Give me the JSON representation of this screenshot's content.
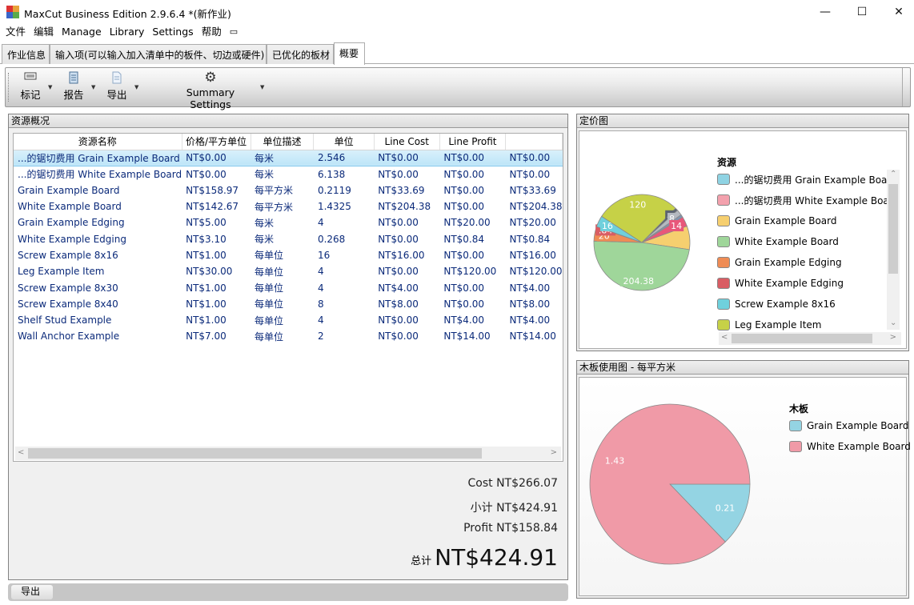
{
  "window": {
    "title": "MaxCut Business Edition 2.9.6.4 *(新作业)",
    "minimize": "—",
    "maximize": "☐",
    "close": "✕"
  },
  "menu": [
    "文件",
    "编辑",
    "Manage",
    "Library",
    "Settings",
    "帮助",
    "▭"
  ],
  "tabs": [
    "作业信息",
    "输入项(可以输入加入清单中的板件、切边或硬件)",
    "已优化的板材",
    "概要"
  ],
  "active_tab": "概要",
  "toolbar": {
    "items": [
      {
        "label": "标记",
        "icon": "label-icon"
      },
      {
        "label": "报告",
        "icon": "report-icon"
      },
      {
        "label": "导出",
        "icon": "export-icon"
      },
      {
        "label": "Summary Settings",
        "icon": "gear-icon"
      }
    ]
  },
  "resources_panel": {
    "title": "资源概况",
    "columns": [
      "资源名称",
      "价格/平方单位",
      "单位描述",
      "单位",
      "Line Cost",
      "Line Profit",
      ""
    ],
    "rows": [
      [
        "...的锯切费用 Grain Example Board",
        "NT$0.00",
        "每米",
        "2.546",
        "NT$0.00",
        "NT$0.00",
        "NT$0.00"
      ],
      [
        "...的锯切费用 White Example Board",
        "NT$0.00",
        "每米",
        "6.138",
        "NT$0.00",
        "NT$0.00",
        "NT$0.00"
      ],
      [
        "Grain Example Board",
        "NT$158.97",
        "每平方米",
        "0.2119",
        "NT$33.69",
        "NT$0.00",
        "NT$33.69"
      ],
      [
        "White Example Board",
        "NT$142.67",
        "每平方米",
        "1.4325",
        "NT$204.38",
        "NT$0.00",
        "NT$204.38"
      ],
      [
        "Grain Example Edging",
        "NT$5.00",
        "每米",
        "4",
        "NT$0.00",
        "NT$20.00",
        "NT$20.00"
      ],
      [
        "White Example Edging",
        "NT$3.10",
        "每米",
        "0.268",
        "NT$0.00",
        "NT$0.84",
        "NT$0.84"
      ],
      [
        "Screw Example 8x16",
        "NT$1.00",
        "每单位",
        "16",
        "NT$16.00",
        "NT$0.00",
        "NT$16.00"
      ],
      [
        "Leg Example Item",
        "NT$30.00",
        "每单位",
        "4",
        "NT$0.00",
        "NT$120.00",
        "NT$120.00"
      ],
      [
        "Screw Example 8x30",
        "NT$1.00",
        "每单位",
        "4",
        "NT$4.00",
        "NT$0.00",
        "NT$4.00"
      ],
      [
        "Screw Example 8x40",
        "NT$1.00",
        "每单位",
        "8",
        "NT$8.00",
        "NT$0.00",
        "NT$8.00"
      ],
      [
        "Shelf Stud Example",
        "NT$1.00",
        "每单位",
        "4",
        "NT$0.00",
        "NT$4.00",
        "NT$4.00"
      ],
      [
        "Wall Anchor Example",
        "NT$7.00",
        "每单位",
        "2",
        "NT$0.00",
        "NT$14.00",
        "NT$14.00"
      ]
    ],
    "selected_row": 0
  },
  "totals": {
    "cost": "Cost NT$266.07",
    "subtotal": "小计 NT$424.91",
    "profit": "Profit NT$158.84",
    "grand_label": "总计",
    "grand_value": "NT$424.91"
  },
  "bottom": {
    "export_label": "导出"
  },
  "pricing_panel": {
    "title": "定价图",
    "legend_title": "资源",
    "legend": [
      {
        "label": "...的锯切费用 Grain Example Board",
        "color": "#8fd3e3"
      },
      {
        "label": "...的锯切费用 White Example Board",
        "color": "#f3a1ad"
      },
      {
        "label": "Grain Example Board",
        "color": "#f6cf6f"
      },
      {
        "label": "White Example Board",
        "color": "#9fd69a"
      },
      {
        "label": "Grain Example Edging",
        "color": "#ef8c55"
      },
      {
        "label": "White Example Edging",
        "color": "#d95d64"
      },
      {
        "label": "Screw Example 8x16",
        "color": "#6fd0dc"
      },
      {
        "label": "Leg Example Item",
        "color": "#c6d147"
      }
    ]
  },
  "usage_panel": {
    "title": "木板使用图 - 每平方米",
    "legend_title": "木板",
    "legend": [
      {
        "label": "Grain Example Board",
        "color": "#94d4e3"
      },
      {
        "label": "White Example Board",
        "color": "#f09aa7"
      }
    ]
  },
  "chart_data": [
    {
      "type": "pie",
      "series": [
        {
          "values": [
            0,
            0,
            33.69,
            204.38,
            20,
            0.84,
            16,
            120,
            4,
            8,
            4,
            14
          ]
        }
      ],
      "categories": [
        "...的锯切费用 Grain Example Board",
        "...的锯切费用 White Example Board",
        "Grain Example Board",
        "White Example Board",
        "Grain Example Edging",
        "White Example Edging",
        "Screw Example 8x16",
        "Leg Example Item",
        "Screw Example 8x30",
        "Screw Example 8x40",
        "Shelf Stud Example",
        "Wall Anchor Example"
      ],
      "colors": [
        "#8fd3e3",
        "#f3a1ad",
        "#f6cf6f",
        "#9fd69a",
        "#ef8c55",
        "#d95d64",
        "#6fd0dc",
        "#c6d147",
        "#5c6470",
        "#b4b9c0",
        "#7f93b0",
        "#e8577a"
      ],
      "data_labels": [
        "",
        "",
        "",
        "204.38",
        "20",
        ".84",
        "16",
        "120",
        "4",
        "8",
        "",
        "14"
      ],
      "title": ""
    },
    {
      "type": "pie",
      "categories": [
        "Grain Example Board",
        "White Example Board"
      ],
      "values": [
        0.21,
        1.43
      ],
      "colors": [
        "#94d4e3",
        "#f09aa7"
      ],
      "data_labels": [
        "0.21",
        "1.43"
      ],
      "title": ""
    }
  ]
}
